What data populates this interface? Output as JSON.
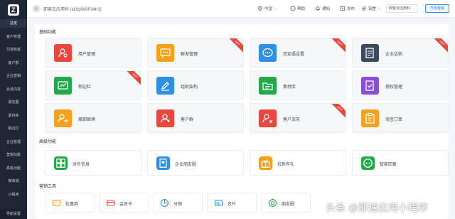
{
  "sidebar": {
    "items": [
      {
        "label": "总览",
        "name": "sidebar-item-overview",
        "active": true
      },
      {
        "label": "客户管理",
        "name": "sidebar-item-customer-management",
        "active": false
      },
      {
        "label": "引流拓客",
        "name": "sidebar-item-traffic",
        "active": false
      },
      {
        "label": "客户群",
        "name": "sidebar-item-customer-groups",
        "active": false
      },
      {
        "label": "企业营销",
        "name": "sidebar-item-enterprise-marketing",
        "active": false
      },
      {
        "label": "会话内容",
        "name": "sidebar-item-session-content",
        "active": false
      },
      {
        "label": "朋友圈",
        "name": "sidebar-item-moments",
        "active": false
      },
      {
        "label": "素材库",
        "name": "sidebar-item-materials",
        "active": false
      },
      {
        "label": "聊边栏",
        "name": "sidebar-item-chat-sidebar",
        "active": false
      },
      {
        "label": "企业管理",
        "name": "sidebar-item-enterprise-management",
        "active": false
      },
      {
        "label": "营销功能",
        "name": "sidebar-item-marketing-functions",
        "active": false
      },
      {
        "label": "高级功能",
        "name": "sidebar-item-advanced-functions",
        "active": false
      },
      {
        "label": "微商城",
        "name": "sidebar-item-micro-mall",
        "active": false
      },
      {
        "label": "小程序",
        "name": "sidebar-item-mini-program",
        "active": false
      }
    ],
    "bottom_label": "导航设置"
  },
  "header": {
    "account": "即客云应用科 (id:8p060F04h3)",
    "region": "中国",
    "help": "帮助",
    "notify": "通知",
    "publish": "发布",
    "settings": "设置",
    "select_value": "即客云应用科",
    "upgrade": "升级套餐"
  },
  "sections": {
    "basic": {
      "title": "基础功能",
      "cards": [
        {
          "label": "用户管理",
          "color": "#e8473e",
          "icon": "user-settings-icon",
          "hot": false
        },
        {
          "label": "群发管理",
          "color": "#f4a21b",
          "icon": "mass-message-icon",
          "hot": true
        },
        {
          "label": "欢迎语设置",
          "color": "#2f8fe6",
          "icon": "chat-bubble-icon",
          "hot": true
        },
        {
          "label": "企业话術",
          "color": "#3b4a5e",
          "icon": "document-icon",
          "hot": true
        },
        {
          "label": "侧边栏",
          "color": "#23a84b",
          "icon": "sidebar-chart-icon",
          "hot": true
        },
        {
          "label": "组织架构",
          "color": "#2f8fe6",
          "icon": "edit-pen-icon",
          "hot": false
        },
        {
          "label": "素材库",
          "color": "#23a84b",
          "icon": "folder-icon",
          "hot": false
        },
        {
          "label": "授权管理",
          "color": "#8a4fd6",
          "icon": "authorization-icon",
          "hot": false
        },
        {
          "label": "离职继承",
          "color": "#f4a21b",
          "icon": "transfer-user-icon",
          "hot": false
        },
        {
          "label": "客户群",
          "color": "#e8473e",
          "icon": "customer-group-icon",
          "hot": false
        },
        {
          "label": "客户流失",
          "color": "#e8473e",
          "icon": "customer-loss-icon",
          "hot": true
        },
        {
          "label": "淘宝订单",
          "color": "#f4a21b",
          "icon": "order-icon",
          "hot": false
        }
      ]
    },
    "advanced": {
      "title": "高级功能",
      "cards": [
        {
          "label": "对外信息",
          "color": "#23a84b",
          "icon": "grid-apps-icon"
        },
        {
          "label": "企业朋友圈",
          "color": "#2f8fe6",
          "icon": "moments-icon"
        },
        {
          "label": "拉新有礼",
          "color": "#f4a21b",
          "icon": "gift-icon"
        },
        {
          "label": "智能回复",
          "color": "#23a84b",
          "icon": "smart-reply-icon"
        }
      ]
    },
    "marketing": {
      "title": "营销工具",
      "cards": [
        {
          "label": "优惠券",
          "color": "#f4a21b",
          "icon": "coupon-icon"
        },
        {
          "label": "会员卡",
          "color": "#e8473e",
          "icon": "member-card-icon"
        },
        {
          "label": "分销",
          "color": "#2f8fe6",
          "icon": "distribution-icon"
        },
        {
          "label": "名片",
          "color": "#2f8fe6",
          "icon": "business-card-icon"
        },
        {
          "label": "朋友圈",
          "color": "#23a84b",
          "icon": "camera-icon"
        }
      ]
    }
  },
  "watermark": "头条 @即速应用小程序"
}
